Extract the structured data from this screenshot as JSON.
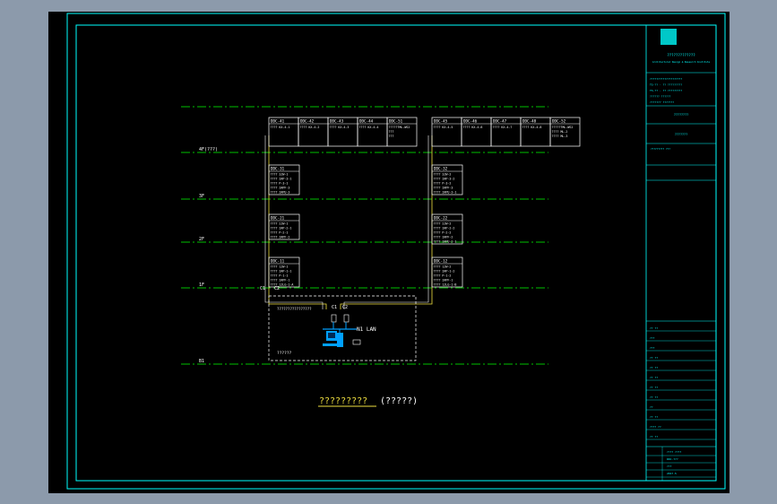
{
  "drawing": {
    "title": "?????????",
    "title_suffix": "(?????)",
    "network_label": "N1 LAN",
    "room_label": "??????",
    "room_header": "????????????????",
    "floors": [
      {
        "id": "roof",
        "label": "4F(???)"
      },
      {
        "id": "3f",
        "label": "3F"
      },
      {
        "id": "2f",
        "label": "2F"
      },
      {
        "id": "1f",
        "label": "1F"
      },
      {
        "id": "b1",
        "label": "B1"
      }
    ],
    "riser_labels": [
      "C1",
      "C2",
      "C1",
      "C2"
    ],
    "ddc_top_left": [
      {
        "name": "DDC-41",
        "lines": [
          "???? KX-4-1"
        ]
      },
      {
        "name": "DDC-42",
        "lines": [
          "???? KX-4-2"
        ]
      },
      {
        "name": "DDC-43",
        "lines": [
          "???? KX-4-3"
        ]
      },
      {
        "name": "DDC-44",
        "lines": [
          "???? KX-4-4"
        ]
      },
      {
        "name": "DDC-51",
        "lines": [
          "??????ML-WS2",
          "???",
          "???"
        ]
      }
    ],
    "ddc_top_right": [
      {
        "name": "DDC-45",
        "lines": [
          "???? KX-4-5"
        ]
      },
      {
        "name": "DDC-46",
        "lines": [
          "???? KX-4-6"
        ]
      },
      {
        "name": "DDC-47",
        "lines": [
          "???? KX-4-7"
        ]
      },
      {
        "name": "DDC-48",
        "lines": [
          "???? KX-4-8"
        ]
      },
      {
        "name": "DDC-52",
        "lines": [
          "??????ML-WS2",
          "???? ML-2",
          "???? ML-3"
        ]
      }
    ],
    "ddc_mid": [
      {
        "name": "DDC-31",
        "lines": [
          "???? 3JW-1",
          "???? ZAP-3-1",
          "???? P-3-1",
          "???? ZAPF-3",
          "???? ZAPU-3"
        ]
      },
      {
        "name": "DDC-32",
        "lines": [
          "???? 3JW-2",
          "???? ZAP-3-2",
          "???? P-3-2",
          "???? ZAPF-3",
          "???? ZAPU-3-1"
        ]
      },
      {
        "name": "DDC-21",
        "lines": [
          "???? 2JW-1",
          "???? ZAP-2-1",
          "???? P-2-1",
          "???? ZAPF-2"
        ]
      },
      {
        "name": "DDC-22",
        "lines": [
          "???? 2JW-2",
          "???? ZAP-2-2",
          "???? P-2-2",
          "???? ZAPF-2",
          "???? ZAPU-2-1"
        ]
      },
      {
        "name": "DDC-11",
        "lines": [
          "???? 1JW-1",
          "???? ZAP-1-1",
          "???? P-1-1",
          "???? ZAPF-1",
          "???? 1JLG-1-A"
        ]
      },
      {
        "name": "DDC-12",
        "lines": [
          "???? 1JW-2",
          "???? ZAP-1-2",
          "???? P-1-2",
          "???? ZAPF-1",
          "???? 1JLG-1-B"
        ]
      }
    ],
    "title_block": {
      "company": "?????????????",
      "company_en": "Architectural Design & Research Institute",
      "rows_top": [
        "????????????????????",
        "TS-?? - ?? ?????????",
        "TS-?? - ?? ?????????",
        "?????? ??????",
        "??????? ???????"
      ],
      "project": "????????",
      "drawing_name": "???????",
      "scale_label": "????????? ???",
      "sign_rows": [
        "?? ??",
        "???",
        "???",
        "?? ??",
        "?? ??",
        "?? ??",
        "?? ??",
        "?? ??",
        "??",
        "?? ??",
        "???? ??",
        "?? ??"
      ],
      "bottom_rows": [
        "???? ????",
        "DDC-???",
        "???",
        "2017.5"
      ]
    },
    "colors": {
      "border": "#00ffff",
      "floor_line": "#00ff00",
      "riser": "#f0e040",
      "text": "#ffffff",
      "pc": "#00a0ff"
    }
  }
}
